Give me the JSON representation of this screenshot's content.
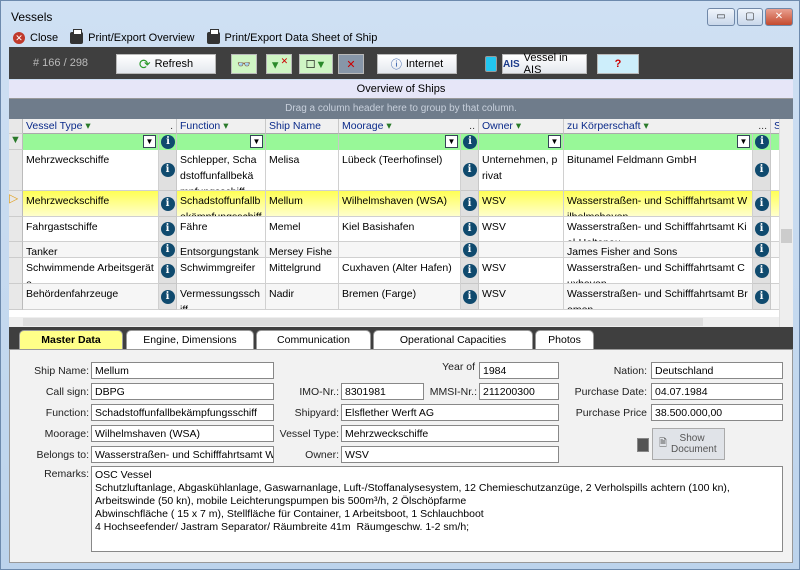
{
  "window": {
    "title": "Vessels",
    "minimize": "▭",
    "maximize": "▢",
    "close": "✕"
  },
  "menu": {
    "close": "Close",
    "print_overview": "Print/Export Overview",
    "print_datasheet": "Print/Export Data Sheet of Ship"
  },
  "toolbar": {
    "record_counter": "# 166 / 298",
    "refresh": "Refresh",
    "internet": "Internet",
    "ais": "Vessel in AIS",
    "ais_badge": "AIS"
  },
  "overview": {
    "title": "Overview of Ships",
    "group_hint": "Drag a column header here to group by that column."
  },
  "columns": [
    "Vessel Type",
    "Function",
    "Ship Name",
    "Moorage",
    "Owner",
    "zu Körperschaft",
    "S"
  ],
  "rows": [
    {
      "vessel_type": "Mehrzweckschiffe",
      "function": "Schlepper, Schadstoffunfallbekämpfungsschiff",
      "ship_name": "Melisa",
      "moorage": "Lübeck (Teerhofinsel)",
      "owner": "Unternehmen, privat",
      "body": "Bitunamel Feldmann GmbH"
    },
    {
      "vessel_type": "Mehrzweckschiffe",
      "function": "Schadstoffunfallbekämpfungsschiff",
      "ship_name": "Mellum",
      "moorage": "Wilhelmshaven (WSA)",
      "owner": "WSV",
      "body": "Wasserstraßen- und Schifffahrtsamt Wilhelmshaven",
      "selected": true
    },
    {
      "vessel_type": "Fahrgastschiffe",
      "function": "Fähre",
      "ship_name": "Memel",
      "moorage": "Kiel Basishafen",
      "owner": "WSV",
      "body": "Wasserstraßen- und Schifffahrtsamt Kiel-Holtenau"
    },
    {
      "vessel_type": "Tanker",
      "function": "Entsorgungstanke",
      "ship_name": "Mersey Fisher",
      "moorage": "",
      "owner": "",
      "body": "James Fisher and Sons"
    },
    {
      "vessel_type": "Schwimmende Arbeitsgeräte",
      "function": "Schwimmgreifer",
      "ship_name": "Mittelgrund",
      "moorage": "Cuxhaven (Alter Hafen)",
      "owner": "WSV",
      "body": "Wasserstraßen- und Schifffahrtsamt Cuxhaven"
    },
    {
      "vessel_type": "Behördenfahrzeuge",
      "function": "Vermessungsschiff",
      "ship_name": "Nadir",
      "moorage": "Bremen (Farge)",
      "owner": "WSV",
      "body": "Wasserstraßen- und Schifffahrtsamt Bremen"
    }
  ],
  "tabs": [
    "Master Data",
    "Engine, Dimensions",
    "Communication",
    "Operational Capacities",
    "Photos"
  ],
  "form": {
    "ship_name": {
      "label": "Ship Name:",
      "value": "Mellum"
    },
    "call_sign": {
      "label": "Call sign:",
      "value": "DBPG"
    },
    "function": {
      "label": "Function:",
      "value": "Schadstoffunfallbekämpfungsschiff"
    },
    "moorage": {
      "label": "Moorage:",
      "value": "Wilhelmshaven (WSA)"
    },
    "belongs_to": {
      "label": "Belongs to:",
      "value": "Wasserstraßen- und Schifffahrtsamt Wilhelmshaven"
    },
    "year": {
      "label": "Year of",
      "value": "1984"
    },
    "imo": {
      "label": "IMO-Nr.:",
      "value": "8301981"
    },
    "mmsi": {
      "label": "MMSI-Nr.:",
      "value": "211200300"
    },
    "shipyard": {
      "label": "Shipyard:",
      "value": "Elsflether Werft AG"
    },
    "vessel_type": {
      "label": "Vessel Type:",
      "value": "Mehrzweckschiffe"
    },
    "owner": {
      "label": "Owner:",
      "value": "WSV"
    },
    "nation": {
      "label": "Nation:",
      "value": "Deutschland"
    },
    "purchase_date": {
      "label": "Purchase Date:",
      "value": "04.07.1984"
    },
    "purchase_price": {
      "label": "Purchase Price",
      "value": "38.500.000,00"
    },
    "show_document": "Show Document",
    "remarks": {
      "label": "Remarks:",
      "value": "OSC Vessel\nSchutzluftanlage, Abgaskühlanlage, Gaswarnanlage, Luft-/Stoffanalysesystem, 12 Chemieschutzanzüge, 2 Verholspills achtern (100 kn), Arbeitswinde (50 kn), mobile Leichterungspumpen bis 500m³/h, 2 Ölschöpfarme\nAbwinschfläche ( 15 x 7 m), Stellfläche für Container, 1 Arbeitsboot, 1 Schlauchboot\n4 Hochseefender/ Jastram Separator/ Räumbreite 41m  Räumgeschw. 1-2 sm/h;"
    }
  },
  "colors": {
    "selected_row": "#ffff66",
    "filter_row": "#98f898",
    "toolbar": "#3f3f3f",
    "active_tab": "#ffff88"
  }
}
